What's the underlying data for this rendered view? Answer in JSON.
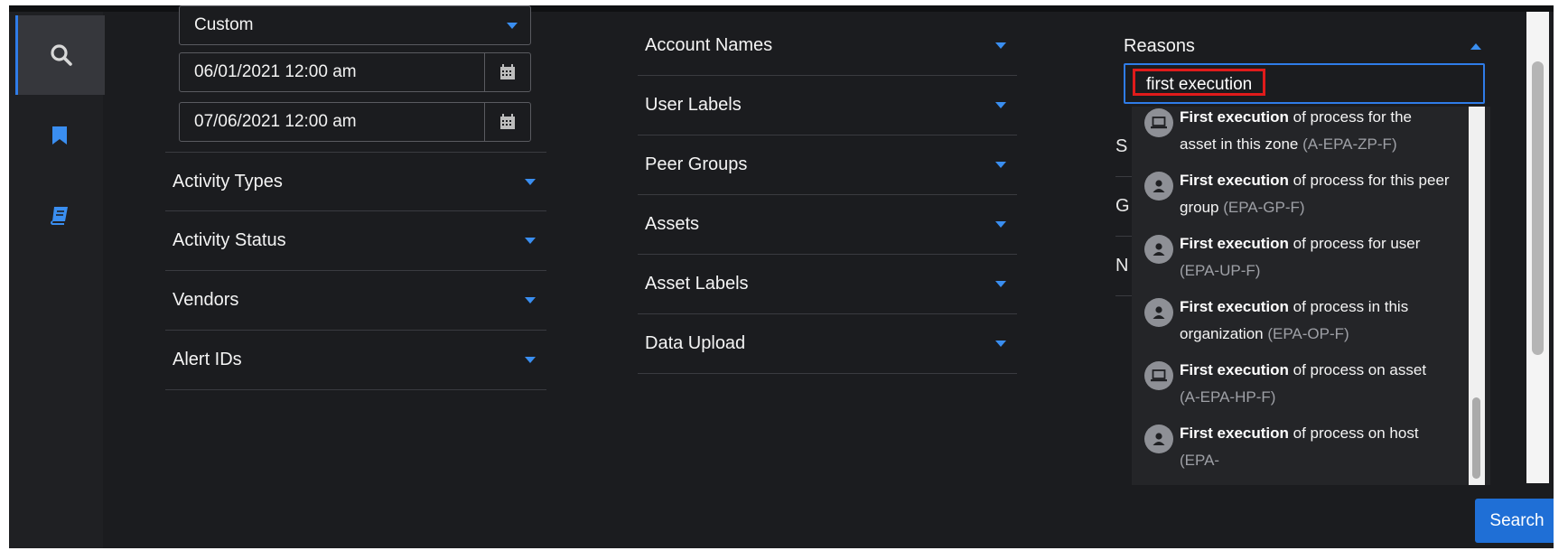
{
  "sidebar": {
    "items": [
      {
        "icon": "search-icon",
        "active": true
      },
      {
        "icon": "bookmark-icon",
        "active": false
      },
      {
        "icon": "book-icon",
        "active": false
      }
    ]
  },
  "date_filter": {
    "range_value": "Custom",
    "start": "06/01/2021 12:00 am",
    "end": "07/06/2021 12:00 am"
  },
  "left_filters": [
    "Activity Types",
    "Activity Status",
    "Vendors",
    "Alert IDs"
  ],
  "middle_filters": [
    "Account Names",
    "User Labels",
    "Peer Groups",
    "Assets",
    "Asset Labels",
    "Data Upload"
  ],
  "reasons": {
    "label": "Reasons",
    "search_value": "first execution",
    "hidden_rows": [
      "S",
      "G",
      "N"
    ],
    "options": [
      {
        "icon": "laptop-icon",
        "match": "First execution",
        "rest": " of process for the asset in this zone",
        "code": "(A-EPA-ZP-F)"
      },
      {
        "icon": "user-icon",
        "match": "First execution",
        "rest": " of process for this peer group",
        "code": "(EPA-GP-F)"
      },
      {
        "icon": "user-icon",
        "match": "First execution",
        "rest": " of process for user",
        "code": "(EPA-UP-F)"
      },
      {
        "icon": "user-icon",
        "match": "First execution",
        "rest": " of process in this organization",
        "code": "(EPA-OP-F)"
      },
      {
        "icon": "laptop-icon",
        "match": "First execution",
        "rest": " of process on asset",
        "code": "(A-EPA-HP-F)"
      },
      {
        "icon": "user-icon",
        "match": "First execution",
        "rest": " of process on host",
        "code": "(EPA-"
      }
    ]
  },
  "actions": {
    "search_label": "Search"
  },
  "colors": {
    "accent": "#2f7ce8",
    "highlight": "#e01b1b",
    "background": "#1b1c1f"
  }
}
